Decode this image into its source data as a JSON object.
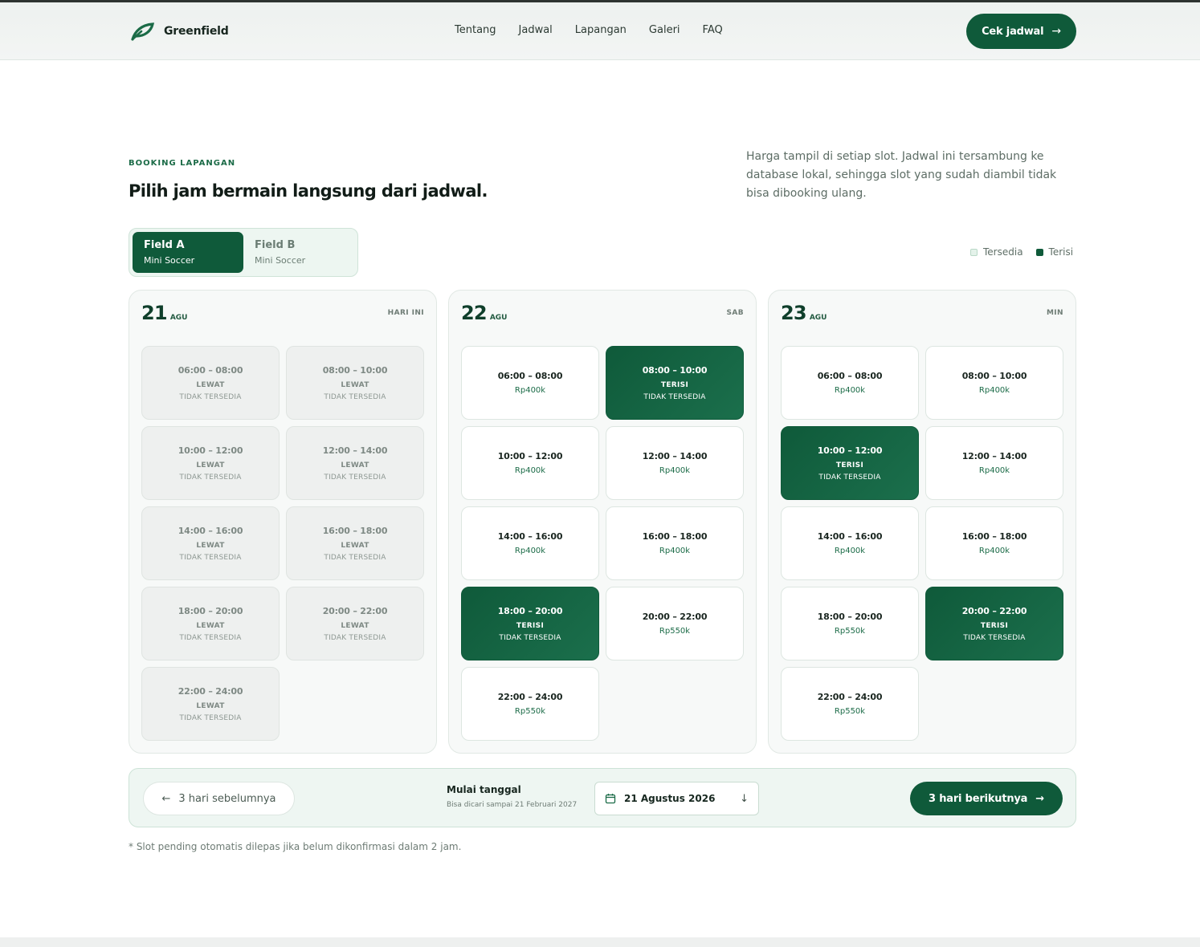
{
  "header": {
    "brand": "Greenfield",
    "nav": [
      "Tentang",
      "Jadwal",
      "Lapangan",
      "Galeri",
      "FAQ"
    ],
    "cta_label": "Cek jadwal",
    "cta_icon": "arrow-right-icon"
  },
  "hero": {
    "eyebrow": "BOOKING LAPANGAN",
    "title": "Pilih jam bermain langsung dari jadwal.",
    "intro": "Harga tampil di setiap slot. Jadwal ini tersambung ke database lokal, sehingga slot yang sudah diambil tidak bisa dibooking ulang."
  },
  "fields": [
    {
      "name": "Field A",
      "type": "Mini Soccer",
      "active": true
    },
    {
      "name": "Field B",
      "type": "Mini Soccer",
      "active": false
    }
  ],
  "legend": {
    "available": "Tersedia",
    "taken": "Terisi"
  },
  "colors": {
    "primary": "#0f5a3a",
    "accent": "#1b6b47",
    "muted": "#6e7c75"
  },
  "days": [
    {
      "num": "21",
      "month": "AGU",
      "label": "HARI INI",
      "slots": [
        {
          "time": "06:00 – 08:00",
          "state": "past",
          "status": "LEWAT",
          "note": "TIDAK TERSEDIA"
        },
        {
          "time": "08:00 – 10:00",
          "state": "past",
          "status": "LEWAT",
          "note": "TIDAK TERSEDIA"
        },
        {
          "time": "10:00 – 12:00",
          "state": "past",
          "status": "LEWAT",
          "note": "TIDAK TERSEDIA"
        },
        {
          "time": "12:00 – 14:00",
          "state": "past",
          "status": "LEWAT",
          "note": "TIDAK TERSEDIA"
        },
        {
          "time": "14:00 – 16:00",
          "state": "past",
          "status": "LEWAT",
          "note": "TIDAK TERSEDIA"
        },
        {
          "time": "16:00 – 18:00",
          "state": "past",
          "status": "LEWAT",
          "note": "TIDAK TERSEDIA"
        },
        {
          "time": "18:00 – 20:00",
          "state": "past",
          "status": "LEWAT",
          "note": "TIDAK TERSEDIA"
        },
        {
          "time": "20:00 – 22:00",
          "state": "past",
          "status": "LEWAT",
          "note": "TIDAK TERSEDIA"
        },
        {
          "time": "22:00 – 24:00",
          "state": "past",
          "status": "LEWAT",
          "note": "TIDAK TERSEDIA"
        }
      ]
    },
    {
      "num": "22",
      "month": "AGU",
      "label": "SAB",
      "slots": [
        {
          "time": "06:00 – 08:00",
          "state": "free",
          "price": "Rp400k"
        },
        {
          "time": "08:00 – 10:00",
          "state": "taken",
          "status": "TERISI",
          "note": "TIDAK TERSEDIA"
        },
        {
          "time": "10:00 – 12:00",
          "state": "free",
          "price": "Rp400k"
        },
        {
          "time": "12:00 – 14:00",
          "state": "free",
          "price": "Rp400k"
        },
        {
          "time": "14:00 – 16:00",
          "state": "free",
          "price": "Rp400k"
        },
        {
          "time": "16:00 – 18:00",
          "state": "free",
          "price": "Rp400k"
        },
        {
          "time": "18:00 – 20:00",
          "state": "taken",
          "status": "TERISI",
          "note": "TIDAK TERSEDIA"
        },
        {
          "time": "20:00 – 22:00",
          "state": "free",
          "price": "Rp550k"
        },
        {
          "time": "22:00 – 24:00",
          "state": "free",
          "price": "Rp550k"
        }
      ]
    },
    {
      "num": "23",
      "month": "AGU",
      "label": "MIN",
      "slots": [
        {
          "time": "06:00 – 08:00",
          "state": "free",
          "price": "Rp400k"
        },
        {
          "time": "08:00 – 10:00",
          "state": "free",
          "price": "Rp400k"
        },
        {
          "time": "10:00 – 12:00",
          "state": "taken",
          "status": "TERISI",
          "note": "TIDAK TERSEDIA"
        },
        {
          "time": "12:00 – 14:00",
          "state": "free",
          "price": "Rp400k"
        },
        {
          "time": "14:00 – 16:00",
          "state": "free",
          "price": "Rp400k"
        },
        {
          "time": "16:00 – 18:00",
          "state": "free",
          "price": "Rp400k"
        },
        {
          "time": "18:00 – 20:00",
          "state": "free",
          "price": "Rp550k"
        },
        {
          "time": "20:00 – 22:00",
          "state": "taken",
          "status": "TERISI",
          "note": "TIDAK TERSEDIA"
        },
        {
          "time": "22:00 – 24:00",
          "state": "free",
          "price": "Rp550k"
        }
      ]
    }
  ],
  "pager": {
    "prev_label": "3 hari sebelumnya",
    "start_label": "Mulai tanggal",
    "start_hint": "Bisa dicari sampai 21 Februari 2027",
    "date_value": "21 Agustus 2026",
    "next_label": "3 hari berikutnya"
  },
  "footnote": "* Slot pending otomatis dilepas jika belum dikonfirmasi dalam 2 jam."
}
